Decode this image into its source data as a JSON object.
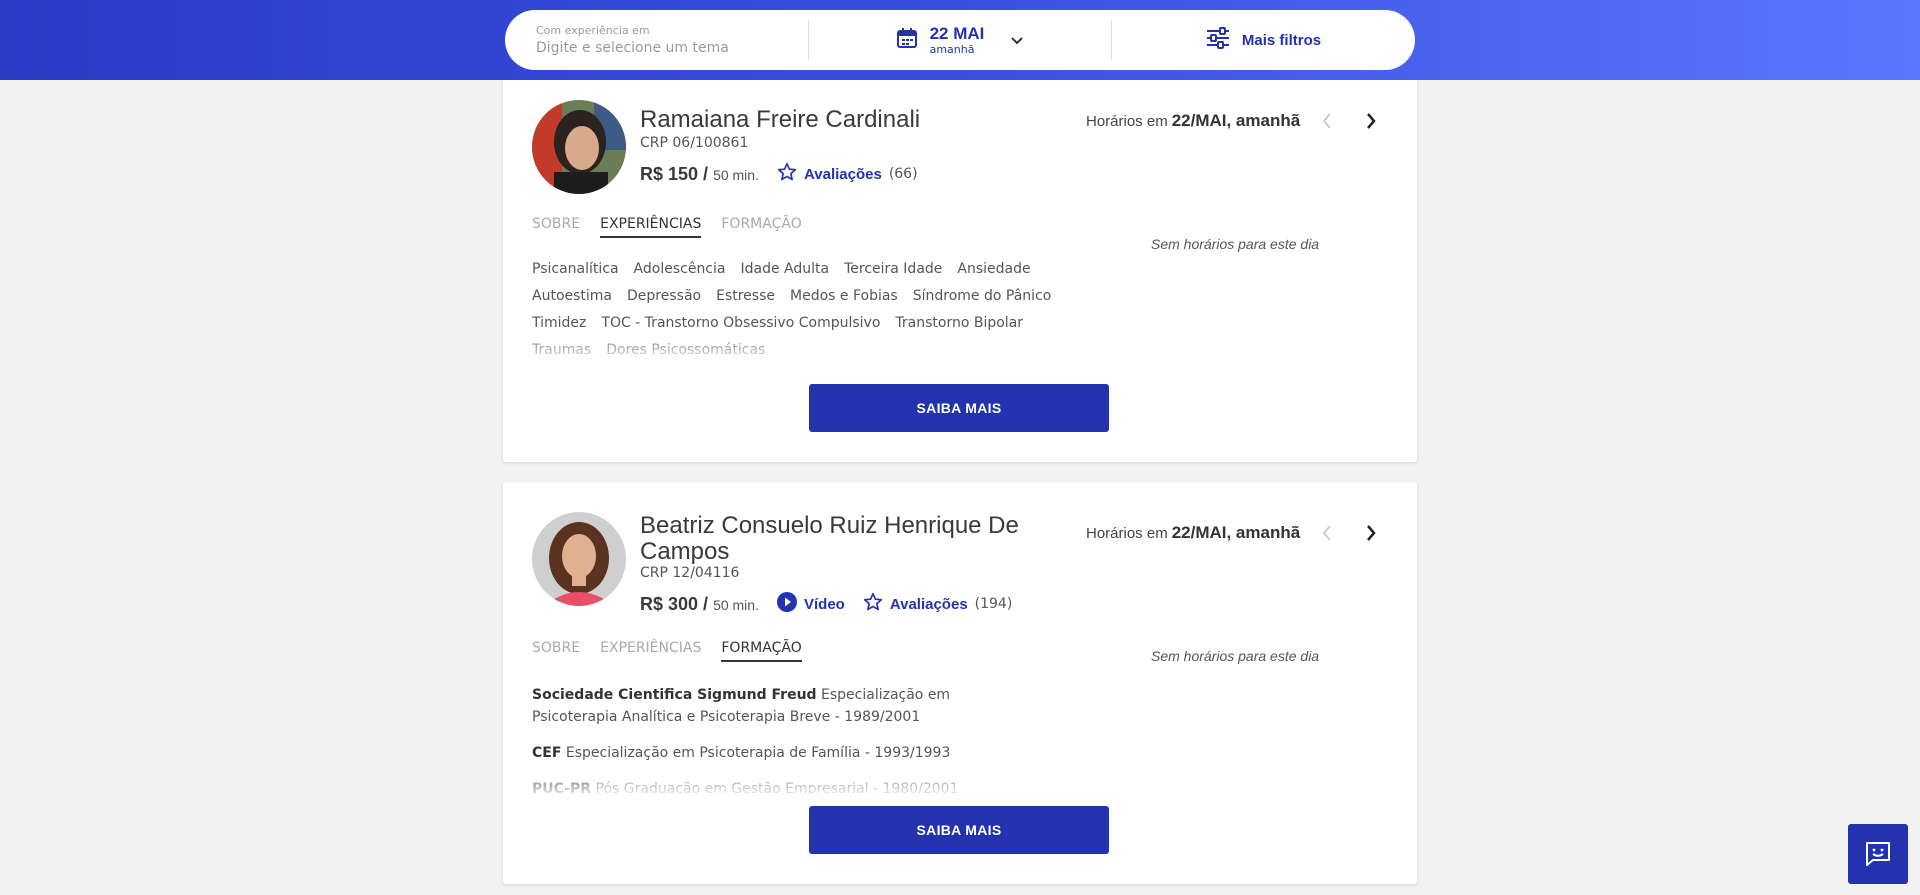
{
  "search": {
    "topic_label": "Com experiência em",
    "topic_placeholder": "Digite e selecione um tema",
    "date_main": "22 MAI",
    "date_sub": "amanhã",
    "filters_label": "Mais filtros"
  },
  "cards": [
    {
      "name": "Ramaiana Freire Cardinali",
      "crp": "CRP 06/100861",
      "price": "R$ 150 /",
      "duration": "50 min.",
      "reviews_label": "Avaliações",
      "reviews_count": "(66)",
      "horarios_label": "Horários em",
      "horarios_date": "22/MAI, amanhã",
      "no_hours": "Sem horários para este dia",
      "tabs": [
        "SOBRE",
        "EXPERIÊNCIAS",
        "FORMAÇÃO"
      ],
      "active_tab": "EXPERIÊNCIAS",
      "tags": [
        "Psicanalítica",
        "Adolescência",
        "Idade Adulta",
        "Terceira Idade",
        "Ansiedade",
        "Autoestima",
        "Depressão",
        "Estresse",
        "Medos e Fobias",
        "Síndrome do Pânico",
        "Timidez",
        "TOC - Transtorno Obsessivo Compulsivo",
        "Transtorno Bipolar",
        "Traumas",
        "Dores Psicossomáticas"
      ],
      "button": "SAIBA MAIS"
    },
    {
      "name": "Beatriz Consuelo Ruiz Henrique De Campos",
      "crp": "CRP 12/04116",
      "price": "R$ 300 /",
      "duration": "50 min.",
      "video_label": "Vídeo",
      "reviews_label": "Avaliações",
      "reviews_count": "(194)",
      "horarios_label": "Horários em",
      "horarios_date": "22/MAI, amanhã",
      "no_hours": "Sem horários para este dia",
      "tabs": [
        "SOBRE",
        "EXPERIÊNCIAS",
        "FORMAÇÃO"
      ],
      "active_tab": "FORMAÇÃO",
      "formacao": [
        {
          "inst": "Sociedade Cientifica Sigmund Freud",
          "desc": "Especialização em Psicoterapia Analítica e Psicoterapia Breve - 1989/2001"
        },
        {
          "inst": "CEF",
          "desc": "Especialização em Psicoterapia de Família - 1993/1993"
        },
        {
          "inst": "PUC-PR",
          "desc": "Pós Graduação em Gestão Empresarial - 1980/2001"
        }
      ],
      "button": "SAIBA MAIS"
    }
  ],
  "colors": {
    "brand": "#2333b0",
    "header_start": "#2a3bc6",
    "header_end": "#5a78ff"
  },
  "icons": [
    "calendar-icon",
    "chevron-down-icon",
    "sliders-icon",
    "star-icon",
    "play-icon",
    "chevron-left-icon",
    "chevron-right-icon",
    "chat-icon"
  ]
}
